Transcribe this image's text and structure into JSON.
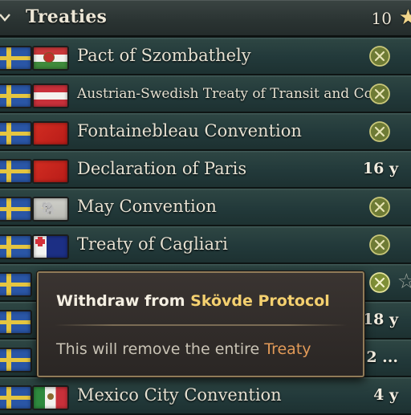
{
  "header": {
    "title": "Treaties",
    "count": "10"
  },
  "rows": [
    {
      "name": "Pact of Szombathely",
      "flag": "hungary",
      "action": "withdraw",
      "duration": ""
    },
    {
      "name": "Austrian-Swedish Treaty of Transit and Co",
      "flag": "austria",
      "action": "withdraw",
      "duration": ""
    },
    {
      "name": "Fontainebleau Convention",
      "flag": "red",
      "action": "withdraw",
      "duration": ""
    },
    {
      "name": "Declaration of Paris",
      "flag": "red",
      "action": "",
      "duration": "16 y"
    },
    {
      "name": "May Convention",
      "flag": "siam",
      "action": "withdraw",
      "duration": ""
    },
    {
      "name": "Treaty of Cagliari",
      "flag": "sardinia",
      "action": "withdraw",
      "duration": ""
    },
    {
      "name": "",
      "flag": "",
      "action": "withdraw",
      "duration": ""
    },
    {
      "name": "",
      "flag": "",
      "action": "",
      "duration": "18 y"
    },
    {
      "name": "",
      "flag": "",
      "action": "",
      "duration": "2 ..."
    },
    {
      "name": "Mexico City Convention",
      "flag": "mexico",
      "action": "",
      "duration": "4 y"
    }
  ],
  "tooltip": {
    "prefix": "Withdraw from ",
    "treaty": "Skövde Protocol",
    "body_prefix": "This will remove the entire ",
    "body_hl": "Treaty"
  },
  "icons": {
    "collapse": "chevron-down-icon",
    "favorite": "star-icon",
    "withdraw": "cancel-x-icon"
  },
  "colors": {
    "title": "#ece6d6",
    "highlight": "#f4d06f",
    "treaty_link": "#e29a58",
    "withdraw_button": "#8a9a3c"
  }
}
